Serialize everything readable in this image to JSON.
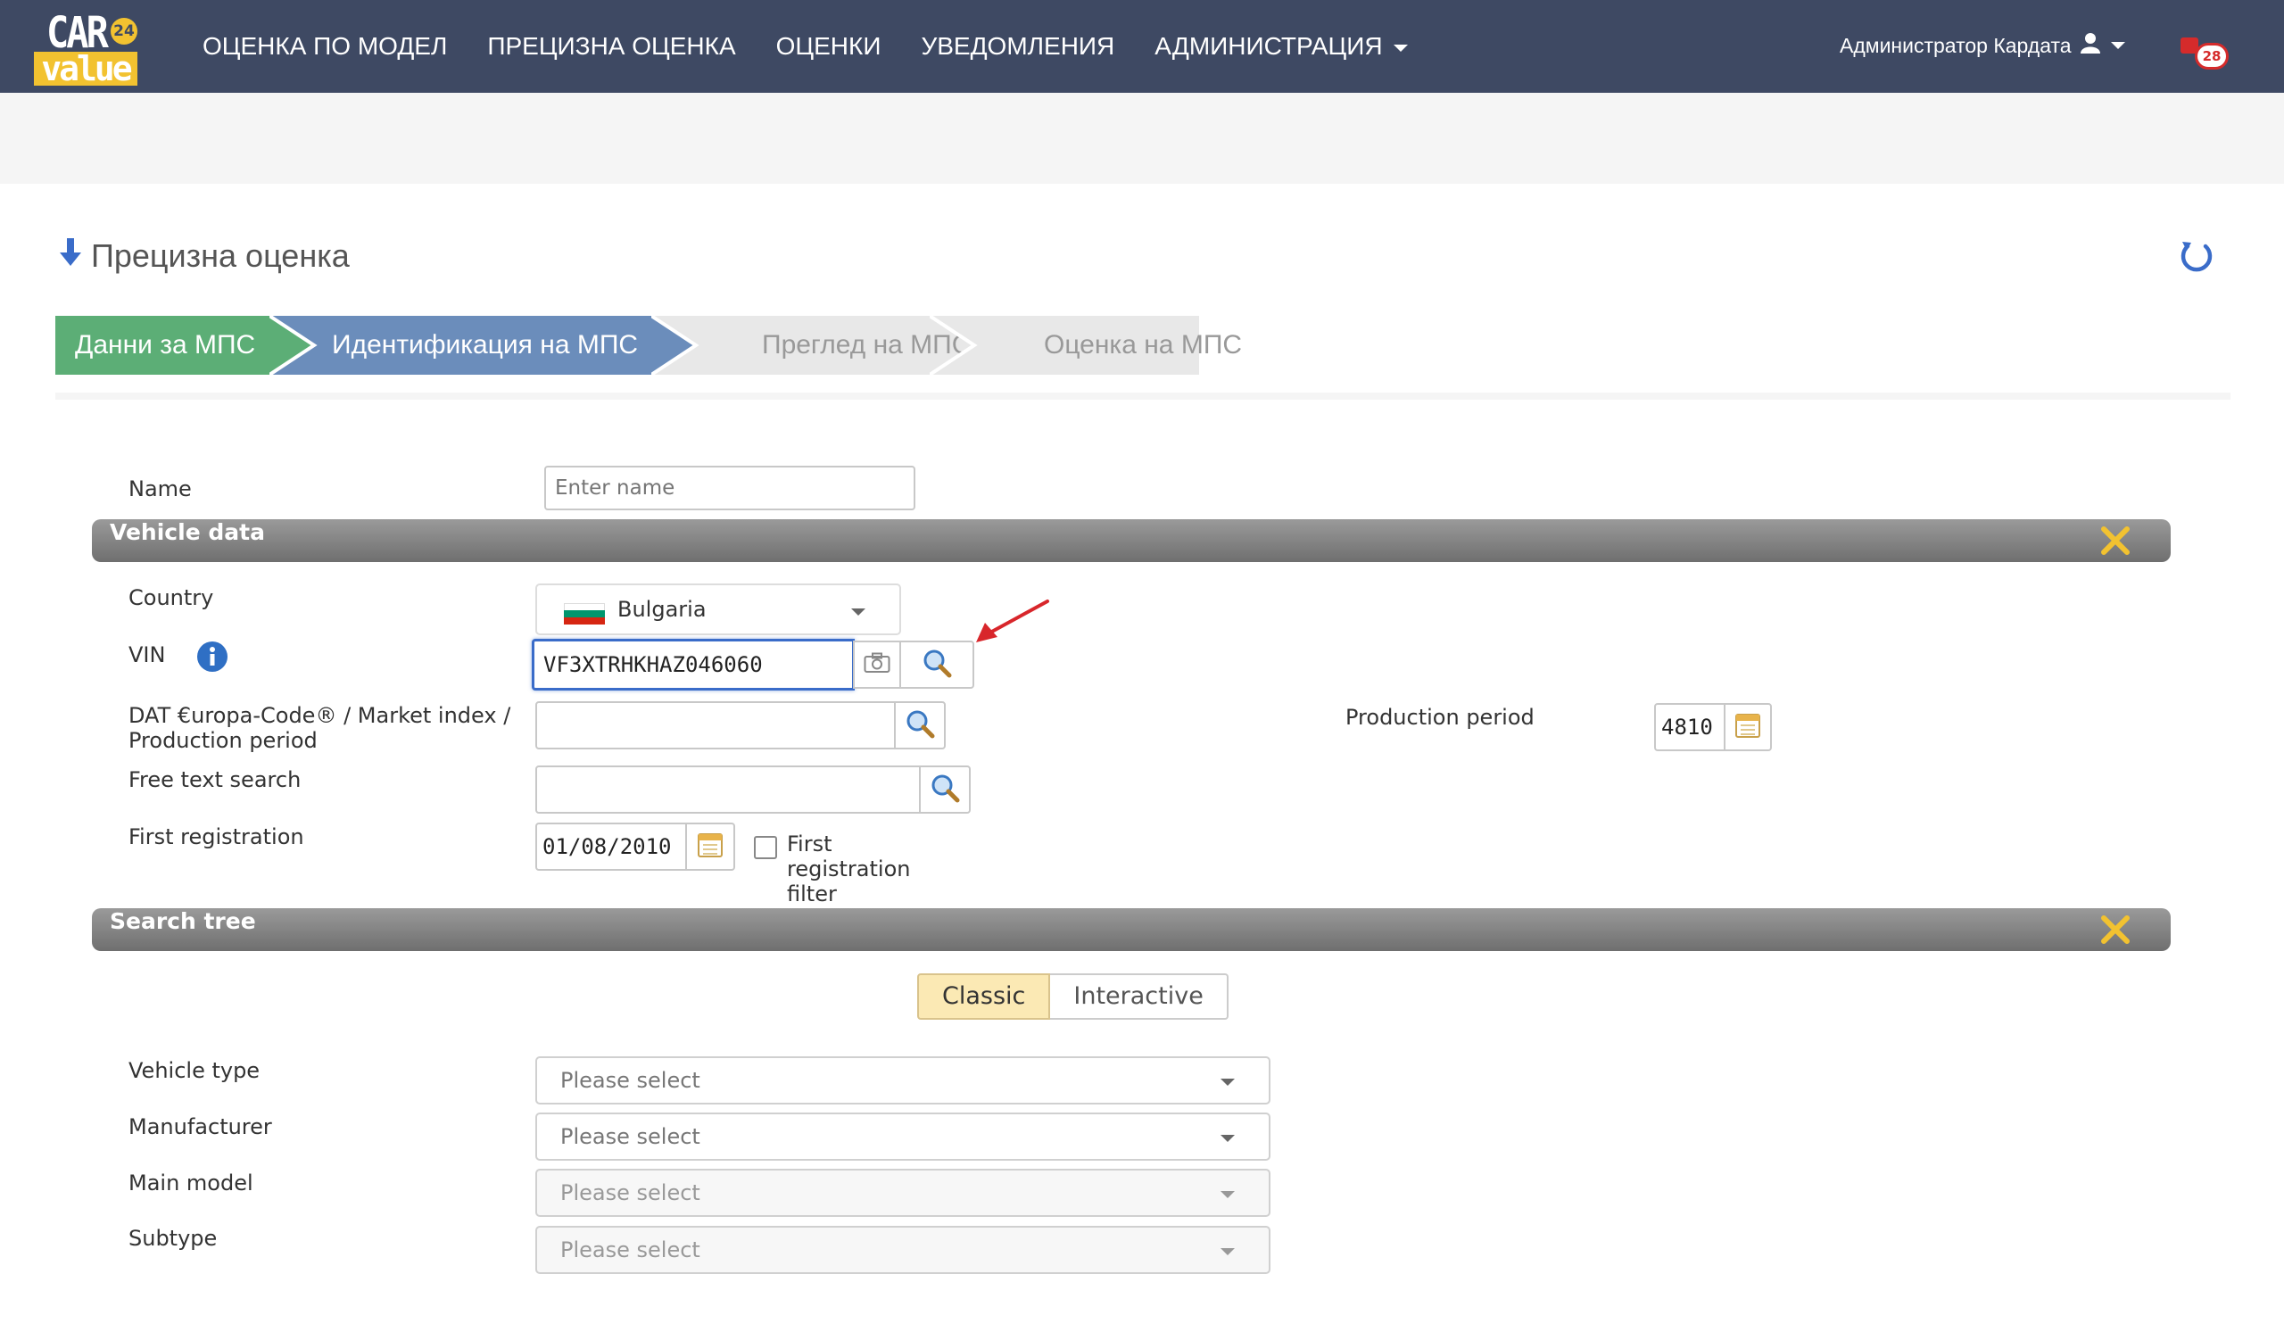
{
  "brand": {
    "line1": "CAR",
    "badge": "24",
    "line2": "value"
  },
  "nav": {
    "items": [
      {
        "label": "ОЦЕНКА ПО МОДЕЛ"
      },
      {
        "label": "ПРЕЦИЗНА ОЦЕНКА"
      },
      {
        "label": "ОЦЕНКИ"
      },
      {
        "label": "УВЕДОМЛЕНИЯ"
      },
      {
        "label": "АДМИНИСТРАЦИЯ"
      }
    ],
    "user": "Администратор Кардата",
    "notifications": "28"
  },
  "page": {
    "title": "Прецизна оценка"
  },
  "steps": [
    {
      "label": "Данни за МПС",
      "state": "done",
      "color": "#5cae76"
    },
    {
      "label": "Идентификация на МПС",
      "state": "active",
      "color": "#6b8dbb"
    },
    {
      "label": "Преглед на МПС",
      "state": "pending",
      "color": "#e8e8e8"
    },
    {
      "label": "Оценка на МПС",
      "state": "pending",
      "color": "#e8e8e8"
    }
  ],
  "form": {
    "name": {
      "label": "Name",
      "placeholder": "Enter name"
    },
    "vehicle_section": "Vehicle data",
    "country": {
      "label": "Country",
      "value": "Bulgaria"
    },
    "vin": {
      "label": "VIN",
      "value": "VF3XTRHKHAZ046060"
    },
    "dat": {
      "label_line1": "DAT €uropa-Code® / Market index /",
      "label_line2": "Production period",
      "value": ""
    },
    "production_period": {
      "label": "Production period",
      "value": "4810"
    },
    "free_text": {
      "label": "Free text search",
      "value": ""
    },
    "first_registration": {
      "label": "First registration",
      "value": "01/08/2010",
      "filter_label_1": "First",
      "filter_label_2": "registration",
      "filter_label_3": "filter"
    },
    "search_tree_section": "Search tree",
    "modes": {
      "classic": "Classic",
      "interactive": "Interactive"
    },
    "vehicle_type": {
      "label": "Vehicle type",
      "value": "Please select"
    },
    "manufacturer": {
      "label": "Manufacturer",
      "value": "Please select"
    },
    "main_model": {
      "label": "Main model",
      "value": "Please select"
    },
    "subtype": {
      "label": "Subtype",
      "value": "Please select"
    }
  },
  "colors": {
    "navbar": "#3e4963",
    "step_done": "#5cae76",
    "step_active": "#6b8dbb",
    "step_pending": "#e8e8e8",
    "accent_yellow": "#f2c230",
    "info_blue": "#2f6fc4",
    "annotation_arrow": "#d8262b"
  }
}
